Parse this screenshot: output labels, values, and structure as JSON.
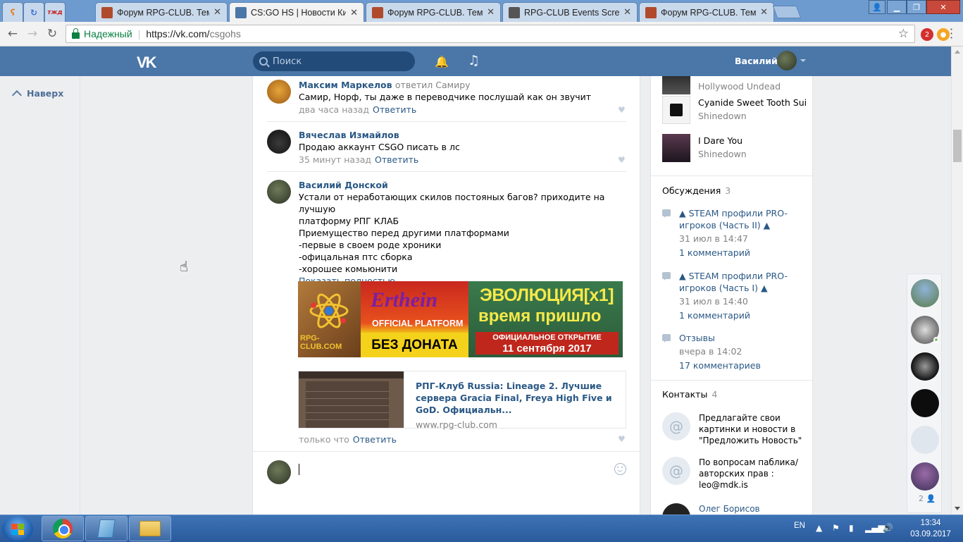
{
  "browser": {
    "tabs": [
      {
        "title": "Форум RPG-CLUB. Тема",
        "active": false
      },
      {
        "title": "CS:GO HS | Новости Кибе",
        "active": true
      },
      {
        "title": "Форум RPG-CLUB. Тема",
        "active": false
      },
      {
        "title": "RPG-CLUB Events Screen",
        "active": false
      },
      {
        "title": "Форум RPG-CLUB. Тема",
        "active": false
      }
    ],
    "pinned_tab_label": "тжд",
    "secure_label": "Надежный",
    "url_host": "https://vk.com/",
    "url_rest": "csgohs",
    "extension_badge": "2"
  },
  "vk": {
    "logo": "VK",
    "search_placeholder": "Поиск",
    "user_name": "Василий",
    "back_to_top": "Наверх"
  },
  "comments": [
    {
      "author": "Максим Маркелов",
      "replied": "ответил Самиру",
      "text": "Самир, Норф, ты даже в переводчике послушай как он звучит",
      "time": "два часа назад",
      "reply_label": "Ответить"
    },
    {
      "author": "Вячеслав Измайлов",
      "replied": "",
      "text": "Продаю аккаунт CSGO писать в лс",
      "time": "35 минут назад",
      "reply_label": "Ответить"
    },
    {
      "author": "Василий Донской",
      "replied": "",
      "text": "Устали от неработающих скилов постояных багов? приходите на лучшую\nплатформу РПГ КЛАБ\nПриемущество перед другими платформами\n-первые в своем роде хроники\n-офицальная птс сборка\n-хорошее комьюнити",
      "show_more": "Показать полностью…",
      "time": "только что",
      "reply_label": "Ответить"
    }
  ],
  "banner": {
    "logo_text": "RPG-CLUB.COM",
    "brand": "Erthein",
    "platform": "OFFICIAL PLATFORM",
    "no_donate": "БЕЗ ДОНАТА",
    "evolution": "ЭВОЛЮЦИЯ[x1]",
    "time_came": "время пришло",
    "opening_line1": "ОФИЦИАЛЬНОЕ ОТКРЫТИЕ",
    "opening_line2": "11 сентября 2017"
  },
  "link_card": {
    "title": "РПГ-Клуб Russia: Lineage 2. Лучшие сервера Gracia Final, Freya High Five и GoD. Официальн...",
    "host": "www.rpg-club.com"
  },
  "right": {
    "tracks": [
      {
        "title": "",
        "artist": "Hollywood Undead"
      },
      {
        "title": "Cyanide Sweet Tooth Sui...",
        "artist": "Shinedown"
      },
      {
        "title": "I Dare You",
        "artist": "Shinedown"
      }
    ],
    "discussions_label": "Обсуждения",
    "discussions_count": "3",
    "topics": [
      {
        "title": "▲ STEAM профили PRO-игроков (Часть II) ▲",
        "date": "31 июл в 14:47",
        "count": "1 комментарий"
      },
      {
        "title": "▲ STEAM профили PRO-игроков (Часть I) ▲",
        "date": "31 июл в 14:40",
        "count": "1 комментарий"
      },
      {
        "title": "Отзывы",
        "date": "вчера в 14:02",
        "count": "17 комментариев"
      }
    ],
    "contacts_label": "Контакты",
    "contacts_count": "4",
    "contacts": [
      {
        "text": "Предлагайте свои картинки и новости в \"Предложить Новость\""
      },
      {
        "text": "По вопросам паблика/авторских прав : leo@mdk.is"
      }
    ],
    "last_contact_name": "Олег Борисов"
  },
  "dock": {
    "count": "2"
  },
  "taskbar": {
    "lang": "EN",
    "time": "13:34",
    "date": "03.09.2017"
  },
  "colors": {
    "vk_blue": "#4a76a8",
    "link": "#2a5885",
    "muted": "#828282"
  }
}
